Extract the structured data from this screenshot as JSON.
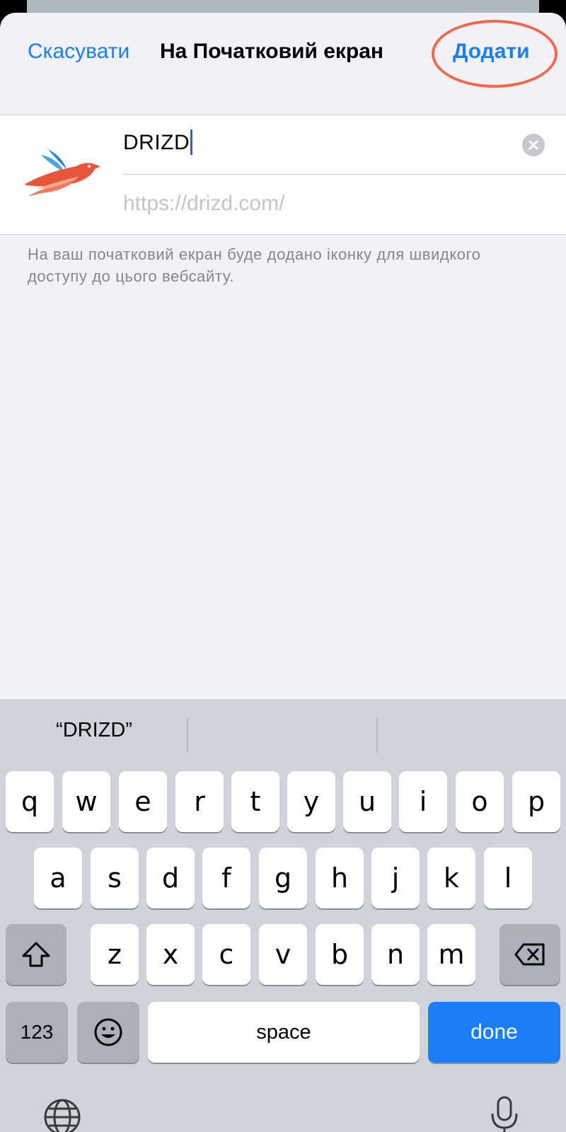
{
  "header": {
    "cancel_label": "Скасувати",
    "title": "На Початковий екран",
    "add_label": "Додати"
  },
  "form": {
    "name_value": "DRIZD",
    "url_value": "https://drizd.com/"
  },
  "hint_text": "На ваш початковий екран буде додано іконку для швидкого доступу до цього вебсайту.",
  "keyboard": {
    "suggestion": "“DRIZD”",
    "row1": [
      "q",
      "w",
      "e",
      "r",
      "t",
      "y",
      "u",
      "i",
      "o",
      "p"
    ],
    "row2": [
      "a",
      "s",
      "d",
      "f",
      "g",
      "h",
      "j",
      "k",
      "l"
    ],
    "row3": [
      "z",
      "x",
      "c",
      "v",
      "b",
      "n",
      "m"
    ],
    "numbers_label": "123",
    "space_label": "space",
    "done_label": "done"
  },
  "colors": {
    "accent": "#1a7ff6",
    "highlight_ring": "#ef6a4d",
    "keyboard_bg": "#d1d3da"
  },
  "icons": {
    "app": "bird-logo-icon",
    "clear": "clear-icon",
    "shift": "shift-icon",
    "delete": "backspace-icon",
    "emoji": "emoji-icon",
    "globe": "globe-icon",
    "mic": "microphone-icon"
  }
}
